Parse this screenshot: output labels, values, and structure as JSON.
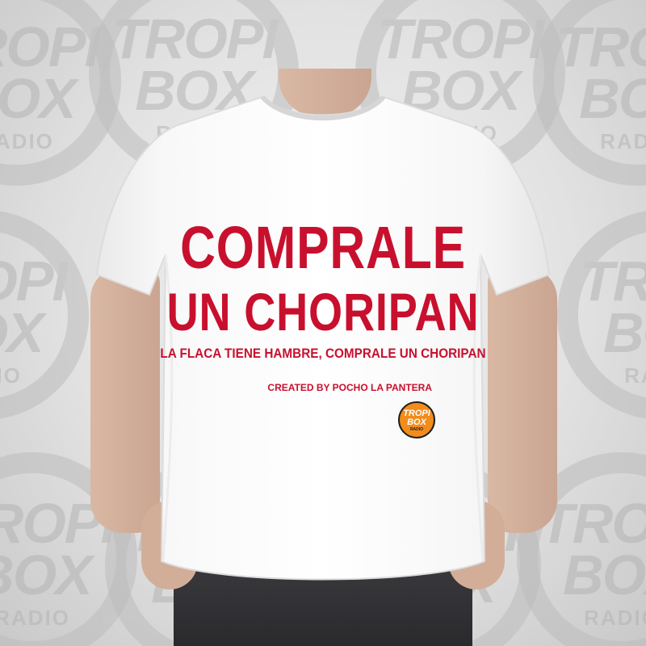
{
  "background_watermark": {
    "line1": "TROPI",
    "line2": "BOX",
    "line3": "RADIO",
    "ring_color": "#bdbdbd"
  },
  "shirt": {
    "headline_line1": "COMPRALE",
    "headline_line2": "UN CHORIPAN",
    "subline": "LA FLACA TIENE HAMBRE, COMPRALE UN CHORIPAN",
    "credit": "CREATED BY POCHO LA PANTERA",
    "print_color": "#c8102e",
    "fabric_color": "#f7f7f7"
  },
  "logo": {
    "line1": "TROPI",
    "line2": "BOX",
    "line3": "RADIO",
    "color": "#f28c1c"
  }
}
